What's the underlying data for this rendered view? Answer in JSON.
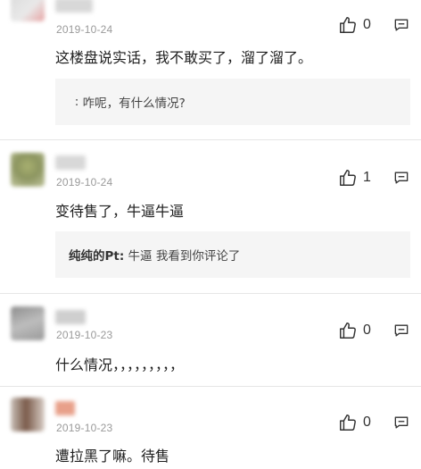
{
  "comments": [
    {
      "date": "2019-10-24",
      "likes": "0",
      "text": "这楼盘说实话，我不敢买了，溜了溜了。",
      "reply": {
        "author": " ",
        "text": "咋呢，有什么情况?"
      }
    },
    {
      "date": "2019-10-24",
      "likes": "1",
      "text": "变待售了，牛逼牛逼",
      "reply": {
        "author": "纯纯的Pt:",
        "text": "牛逼 我看到你评论了"
      }
    },
    {
      "date": "2019-10-23",
      "likes": "0",
      "text": "什么情况，，，，，，，，，"
    },
    {
      "date": "2019-10-23",
      "likes": "0",
      "text": "遭拉黑了嘛。待售"
    }
  ],
  "icons": {
    "like": "thumbs-up-icon",
    "reply": "comment-bubble-icon"
  }
}
